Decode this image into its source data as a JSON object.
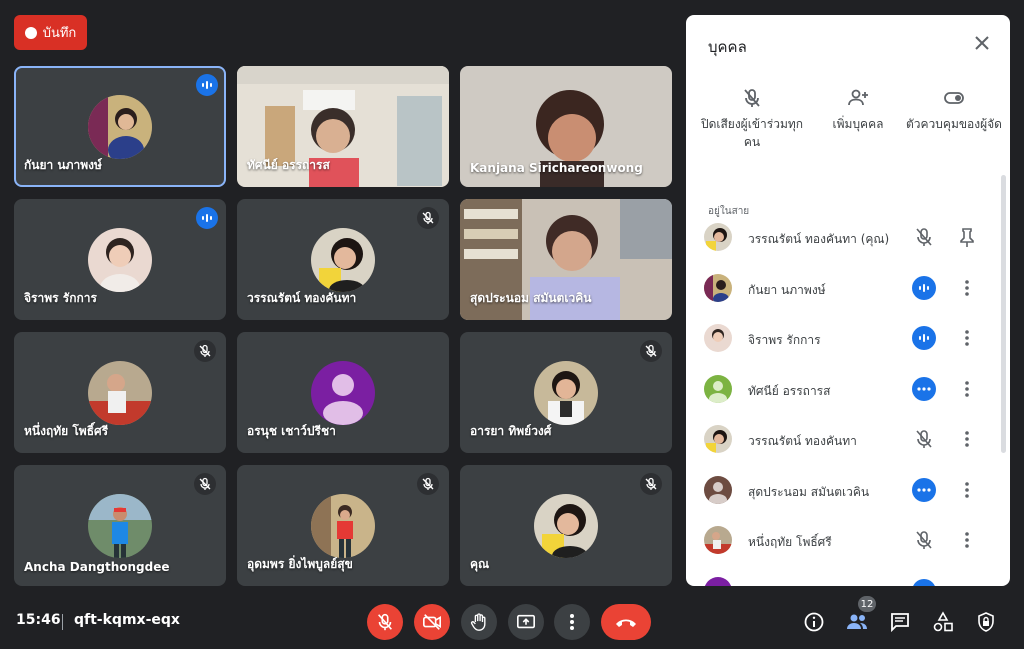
{
  "record": {
    "label": "บันทึก"
  },
  "tiles": [
    {
      "name": "กันยา นภาพงษ์"
    },
    {
      "name": "ทัศนีย์ อรรถารส"
    },
    {
      "name": "Kanjana Sirichareonwong"
    },
    {
      "name": "จิราพร รักการ"
    },
    {
      "name": "วรรณรัตน์ ทองคันทา"
    },
    {
      "name": "สุดประนอม สมันตเวคิน"
    },
    {
      "name": "หนึ่งฤทัย โพธิ์ศรี"
    },
    {
      "name": "อรนุช เชาว์ปรีชา"
    },
    {
      "name": "อารยา ทิพย์วงศ์"
    },
    {
      "name": "Ancha Dangthongdee"
    },
    {
      "name": "อุดมพร ยิ่งไพบูลย์สุข"
    },
    {
      "name": "คุณ"
    }
  ],
  "panel": {
    "title": "บุคคล",
    "actions": [
      {
        "label": "ปิดเสียงผู้เข้าร่วมทุกคน",
        "icon": "mic-off-icon"
      },
      {
        "label": "เพิ่มบุคคล",
        "icon": "person-add-icon"
      },
      {
        "label": "ตัวควบคุมของผู้จัด",
        "icon": "toggle-icon"
      }
    ],
    "section_label": "อยู่ในสาย",
    "participants": [
      {
        "name": "วรรณรัตน์ ทองคันทา (คุณ)",
        "state": "muted",
        "extra": "pin"
      },
      {
        "name": "กันยา นภาพงษ์",
        "state": "speaking"
      },
      {
        "name": "จิราพร รักการ",
        "state": "speaking"
      },
      {
        "name": "ทัศนีย์ อรรถารส",
        "state": "dots"
      },
      {
        "name": "วรรณรัตน์ ทองคันทา",
        "state": "muted"
      },
      {
        "name": "สุดประนอม สมันตเวคิน",
        "state": "dots"
      },
      {
        "name": "หนึ่งฤทัย โพธิ์ศรี",
        "state": "muted"
      }
    ]
  },
  "bottom": {
    "time": "15:46",
    "meeting_code": "qft-kqmx-eqx",
    "participant_count": "12"
  },
  "colors": {
    "accent": "#1a73e8",
    "danger": "#ea4335",
    "bg": "#202124",
    "tile": "#3c4043"
  }
}
